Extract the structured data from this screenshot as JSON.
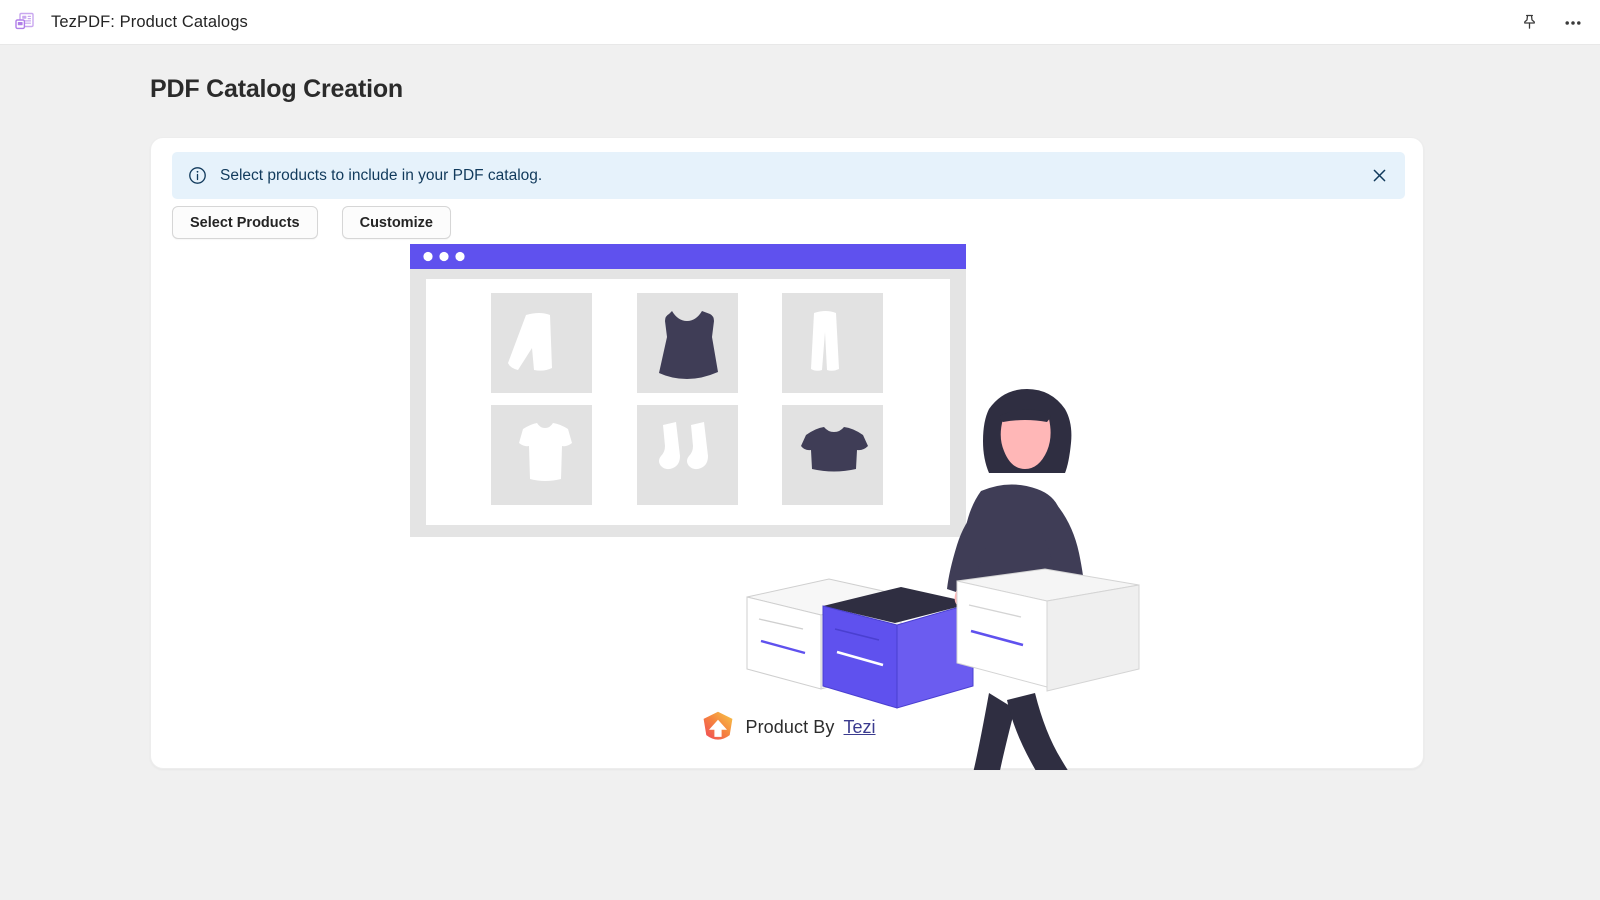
{
  "appbar": {
    "icon": "catalog-app-icon",
    "title": "TezPDF: Product Catalogs",
    "pin_icon": "pin-icon",
    "more_icon": "more-horizontal-icon"
  },
  "page": {
    "title": "PDF Catalog Creation"
  },
  "banner": {
    "icon": "info-circle-icon",
    "message": "Select products to include in your PDF catalog.",
    "close_icon": "close-icon",
    "background_color": "#e6f2fb",
    "text_color": "#113a5c"
  },
  "actions": {
    "select_products_label": "Select Products",
    "customize_label": "Customize"
  },
  "illustration": {
    "name": "pdf-catalog-illustration",
    "browser_mockup": {
      "titlebar_color": "#5f51ee",
      "dots": 3,
      "frame_color": "#e3e3e3",
      "content_color": "#ffffff",
      "products": [
        {
          "name": "skirt-thumbnail",
          "tone": "light"
        },
        {
          "name": "dress-thumbnail",
          "tone": "dark"
        },
        {
          "name": "trousers-thumbnail",
          "tone": "light"
        },
        {
          "name": "tshirt-thumbnail",
          "tone": "light"
        },
        {
          "name": "socks-thumbnail",
          "tone": "light"
        },
        {
          "name": "crop-top-thumbnail",
          "tone": "dark"
        }
      ]
    },
    "boxes": [
      {
        "name": "white-box",
        "color": "#ffffff"
      },
      {
        "name": "purple-box",
        "color": "#5f51ee"
      }
    ],
    "person": {
      "name": "person-carrying-box",
      "hair_color": "#2f2e41",
      "skin_color": "#ffb7b7",
      "clothing_color": "#3f3d56"
    }
  },
  "branding": {
    "logo": "tezi-shield-logo",
    "text": "Product By",
    "link_label": "Tezi",
    "link_color": "#3b3b8f"
  },
  "colors": {
    "accent": "#5f51ee",
    "page_background": "#f0f0f0",
    "card_background": "#ffffff"
  }
}
